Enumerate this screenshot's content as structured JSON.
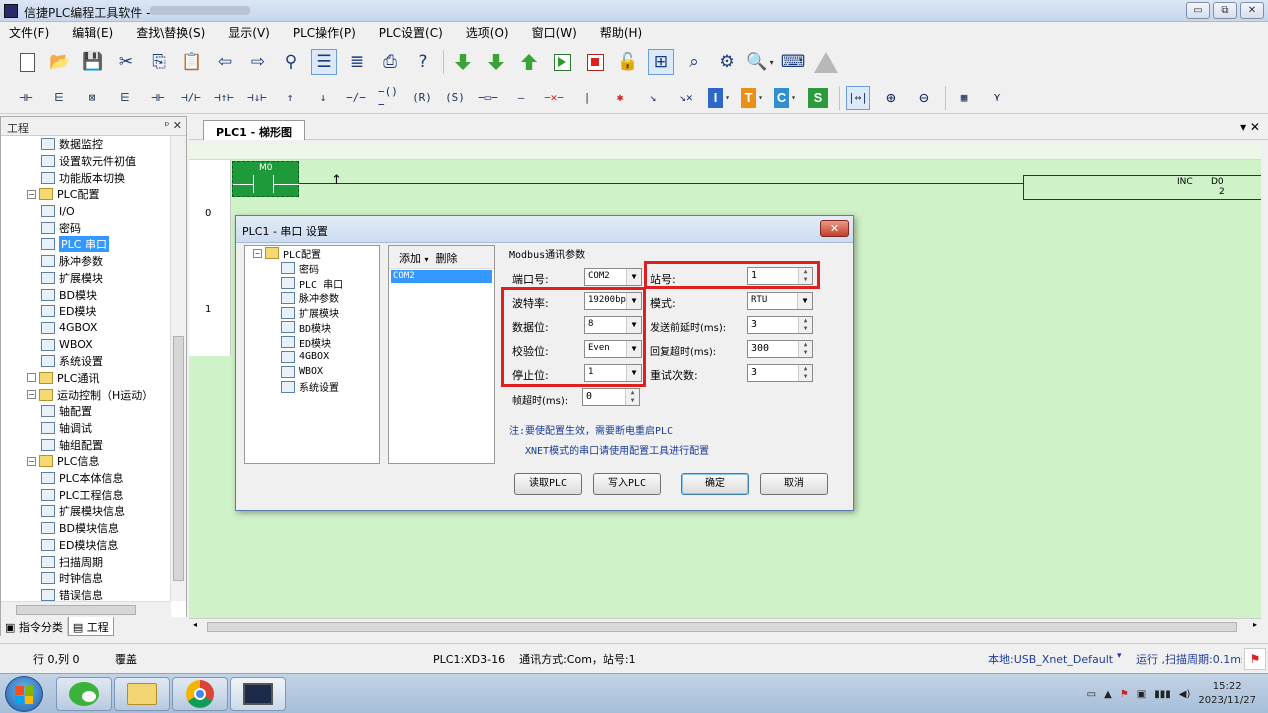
{
  "window": {
    "title": "信捷PLC编程工具软件 -",
    "controls": [
      "▭",
      "⧉",
      "✕"
    ]
  },
  "menu": [
    "文件(F)",
    "编辑(E)",
    "查找\\替换(S)",
    "显示(V)",
    "PLC操作(P)",
    "PLC设置(C)",
    "选项(O)",
    "窗口(W)",
    "帮助(H)"
  ],
  "toolbar2": {
    "letter_buttons": [
      {
        "label": "I",
        "color": "#2f67c8"
      },
      {
        "label": "T",
        "color": "#e8901a"
      },
      {
        "label": "C",
        "color": "#2f8fd0"
      },
      {
        "label": "S",
        "color": "#2a9a3a"
      }
    ]
  },
  "project_panel": {
    "title": "工程",
    "pin": "ᵖ ✕",
    "tree": [
      {
        "label": "数据监控",
        "level": 2
      },
      {
        "label": "设置软元件初值",
        "level": 2
      },
      {
        "label": "功能版本切换",
        "level": 2
      },
      {
        "label": "PLC配置",
        "level": 1,
        "expander": "−",
        "folder": true
      },
      {
        "label": "I/O",
        "level": 2
      },
      {
        "label": "密码",
        "level": 2
      },
      {
        "label": "PLC 串口",
        "level": 2,
        "selected": true
      },
      {
        "label": "脉冲参数",
        "level": 2
      },
      {
        "label": "扩展模块",
        "level": 2
      },
      {
        "label": "BD模块",
        "level": 2
      },
      {
        "label": "ED模块",
        "level": 2
      },
      {
        "label": "4GBOX",
        "level": 2
      },
      {
        "label": "WBOX",
        "level": 2
      },
      {
        "label": "系统设置",
        "level": 2
      },
      {
        "label": "PLC通讯",
        "level": 1,
        "folder": true
      },
      {
        "label": "运动控制（H运动）",
        "level": 1,
        "expander": "−",
        "folder": true
      },
      {
        "label": "轴配置",
        "level": 2
      },
      {
        "label": "轴调试",
        "level": 2
      },
      {
        "label": "轴组配置",
        "level": 2
      },
      {
        "label": "PLC信息",
        "level": 1,
        "expander": "−",
        "folder": true
      },
      {
        "label": "PLC本体信息",
        "level": 2
      },
      {
        "label": "PLC工程信息",
        "level": 2
      },
      {
        "label": "扩展模块信息",
        "level": 2
      },
      {
        "label": "BD模块信息",
        "level": 2
      },
      {
        "label": "ED模块信息",
        "level": 2
      },
      {
        "label": "扫描周期",
        "level": 2
      },
      {
        "label": "时钟信息",
        "level": 2
      },
      {
        "label": "错误信息",
        "level": 2
      }
    ],
    "tabs": [
      "指令分类",
      "工程"
    ]
  },
  "editor": {
    "tab_label": "PLC1 - 梯形图",
    "tab_controls": "▾ ✕",
    "rung_numbers": [
      "0",
      "1"
    ],
    "contact_label": "M0",
    "instruction": "INC",
    "instruction_operand": "D0",
    "instruction_arg": "2"
  },
  "dialog": {
    "title": "PLC1 - 串口  设置",
    "close": "✕",
    "tree": [
      {
        "label": "PLC配置",
        "root": true
      },
      {
        "label": "密码"
      },
      {
        "label": "PLC 串口"
      },
      {
        "label": "脉冲参数"
      },
      {
        "label": "扩展模块"
      },
      {
        "label": "BD模块"
      },
      {
        "label": "ED模块"
      },
      {
        "label": "4GBOX"
      },
      {
        "label": "WBOX"
      },
      {
        "label": "系统设置"
      }
    ],
    "list_add": "添加",
    "list_delete": "删除",
    "port_item": "COM2",
    "group_title": "Modbus通讯参数",
    "fields": {
      "port_label": "端口号:",
      "port_value": "COM2",
      "baud_label": "波特率:",
      "baud_value": "19200bps",
      "databits_label": "数据位:",
      "databits_value": "8",
      "parity_label": "校验位:",
      "parity_value": "Even",
      "stopbits_label": "停止位:",
      "stopbits_value": "1",
      "frame_timeout_label": "帧超时(ms):",
      "frame_timeout_value": "0",
      "station_label": "站号:",
      "station_value": "1",
      "mode_label": "模式:",
      "mode_value": "RTU",
      "send_delay_label": "发送前延时(ms):",
      "send_delay_value": "3",
      "reply_timeout_label": "回复超时(ms):",
      "reply_timeout_value": "300",
      "retries_label": "重试次数:",
      "retries_value": "3"
    },
    "note_line1": "注:要使配置生效，需要断电重启PLC",
    "note_line2": "XNET模式的串口请使用配置工具进行配置",
    "buttons": {
      "read": "读取PLC",
      "write": "写入PLC",
      "ok": "确定",
      "cancel": "取消"
    }
  },
  "status": {
    "position": "行 0,列 0",
    "mode": "覆盖",
    "plc_info": "PLC1:XD3-16    通讯方式:Com，站号:1",
    "connection": "本地:USB_Xnet_Default",
    "run_state": "运行 ,扫描周期:0.1ms"
  },
  "taskbar": {
    "time": "15:22",
    "date": "2023/11/27"
  },
  "colors": {
    "ladder_bg": "#d0f2c8",
    "contact": "#1f9a3a",
    "highlight_box": "#e02020",
    "selection": "#3399ff"
  }
}
